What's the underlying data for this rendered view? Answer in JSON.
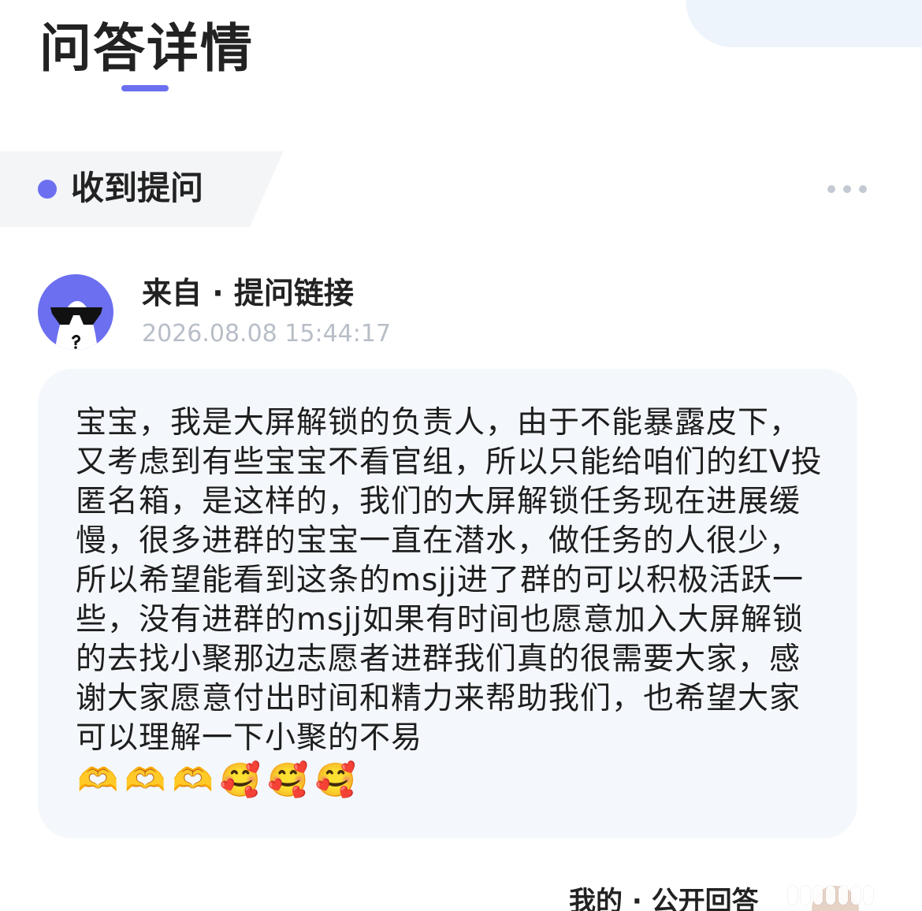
{
  "page": {
    "title": "问答详情"
  },
  "section": {
    "title": "收到提问"
  },
  "question": {
    "sender": "来自 · 提问链接",
    "timestamp": "2026.08.08 15:44:17",
    "content": "宝宝，我是大屏解锁的负责人，由于不能暴露皮下，又考虑到有些宝宝不看官组，所以只能给咱们的红V投匿名箱，是这样的，我们的大屏解锁任务现在进展缓慢，很多进群的宝宝一直在潜水，做任务的人很少，所以希望能看到这条的msjj进了群的可以积极活跃一些，没有进群的msjj如果有时间也愿意加入大屏解锁的去找小聚那边志愿者进群我们真的很需要大家，感谢大家愿意付出时间和精力来帮助我们，也希望大家可以理解一下小聚的不易",
    "emojis": [
      "🫶",
      "🫶",
      "🫶",
      "🥰",
      "🥰",
      "🥰"
    ]
  },
  "answer": {
    "label": "我的 · 公开回答"
  },
  "icons": {
    "more": "more-horizontal-icon",
    "avatar": "sunglasses-avatar-icon"
  },
  "colors": {
    "accent": "#6b6ff0",
    "card_background": "#f4f8fc",
    "timestamp": "#b8bec7",
    "more_dots": "#c4cad3"
  }
}
